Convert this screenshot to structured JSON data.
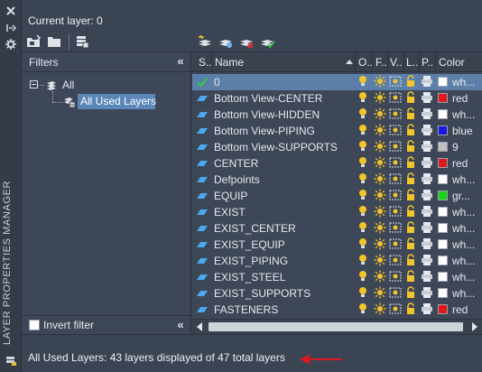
{
  "panel": {
    "vertical_title": "LAYER PROPERTIES MANAGER",
    "current_layer": "Current layer: 0"
  },
  "filters": {
    "title": "Filters",
    "tree": [
      {
        "label": "All",
        "expanded": true
      },
      {
        "label": "All Used Layers",
        "selected": true
      }
    ],
    "invert_label": "Invert filter",
    "invert_checked": false
  },
  "grid": {
    "columns": [
      "S..",
      "Name",
      "O..",
      "F..",
      "V..",
      "L..",
      "P..",
      "Color"
    ],
    "rows": [
      {
        "name": "0",
        "status": "current",
        "color_hex": "#ffffff",
        "color_name": "wh...",
        "selected": true
      },
      {
        "name": "Bottom View-CENTER",
        "status": "layer",
        "color_hex": "#e01a1a",
        "color_name": "red"
      },
      {
        "name": "Bottom View-HIDDEN",
        "status": "layer",
        "color_hex": "#ffffff",
        "color_name": "wh..."
      },
      {
        "name": "Bottom View-PIPING",
        "status": "layer",
        "color_hex": "#1616e6",
        "color_name": "blue"
      },
      {
        "name": "Bottom View-SUPPORTS",
        "status": "layer",
        "color_hex": "#c0c0c0",
        "color_name": "9"
      },
      {
        "name": "CENTER",
        "status": "layer",
        "color_hex": "#e01a1a",
        "color_name": "red"
      },
      {
        "name": "Defpoints",
        "status": "layer",
        "color_hex": "#ffffff",
        "color_name": "wh..."
      },
      {
        "name": "EQUIP",
        "status": "layer",
        "color_hex": "#16d416",
        "color_name": "gr..."
      },
      {
        "name": "EXIST",
        "status": "layer",
        "color_hex": "#ffffff",
        "color_name": "wh..."
      },
      {
        "name": "EXIST_CENTER",
        "status": "layer",
        "color_hex": "#ffffff",
        "color_name": "wh..."
      },
      {
        "name": "EXIST_EQUIP",
        "status": "layer",
        "color_hex": "#ffffff",
        "color_name": "wh..."
      },
      {
        "name": "EXIST_PIPING",
        "status": "layer",
        "color_hex": "#ffffff",
        "color_name": "wh..."
      },
      {
        "name": "EXIST_STEEL",
        "status": "layer",
        "color_hex": "#ffffff",
        "color_name": "wh..."
      },
      {
        "name": "EXIST_SUPPORTS",
        "status": "layer",
        "color_hex": "#ffffff",
        "color_name": "wh..."
      },
      {
        "name": "FASTENERS",
        "status": "layer",
        "color_hex": "#e01a1a",
        "color_name": "red"
      }
    ]
  },
  "status": {
    "text": "All Used Layers: 43 layers displayed of 47 total layers",
    "arrow_color": "#e0161e"
  },
  "icons": {
    "close": "close-icon",
    "pin": "pin-icon",
    "settings": "gear-icon",
    "new_property_filter": "new-property-filter-icon",
    "new_group_filter": "new-group-filter-icon",
    "layer_states": "layer-states-icon",
    "new_layer": "new-layer-icon",
    "new_layer_vp_frozen": "new-layer-vp-frozen-icon",
    "delete_layer": "delete-layer-icon",
    "set_current": "set-current-icon"
  }
}
